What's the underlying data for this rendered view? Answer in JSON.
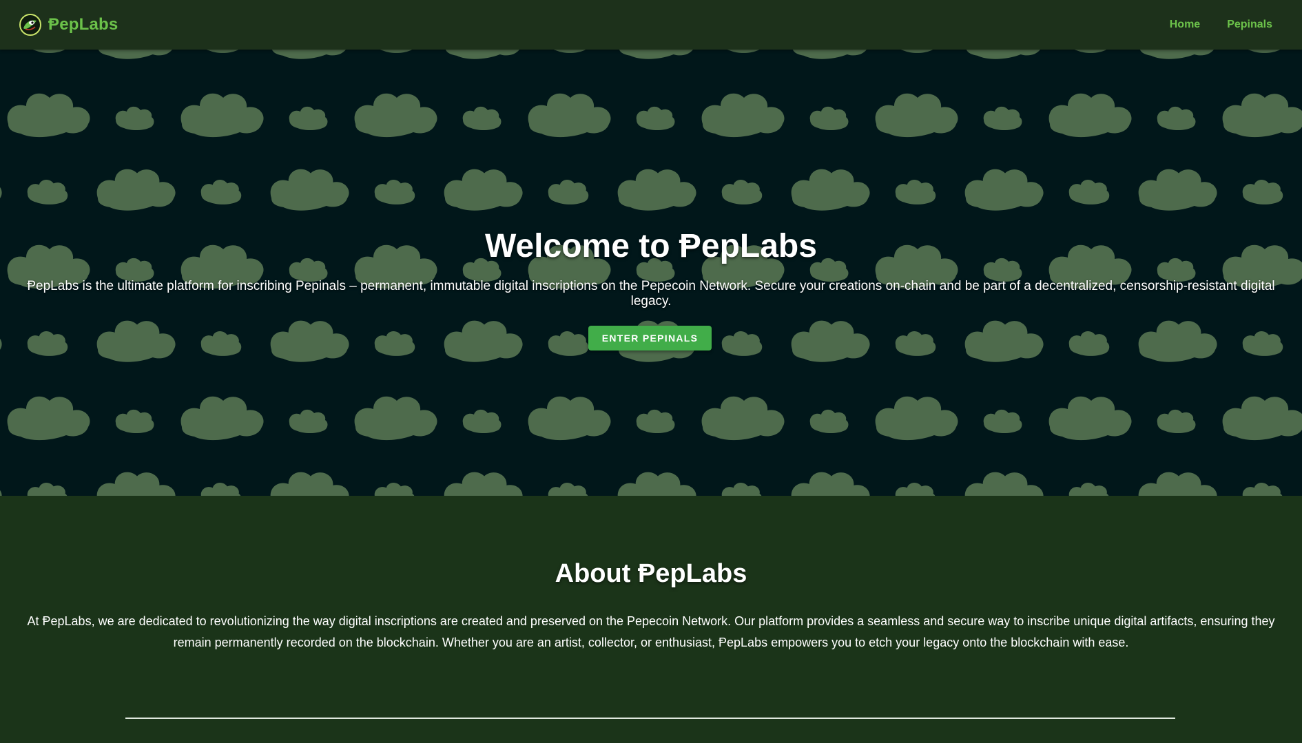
{
  "navbar": {
    "brand_name": "ⱣepLabs",
    "links": [
      {
        "label": "Home"
      },
      {
        "label": "Pepinals"
      }
    ]
  },
  "hero": {
    "title": "Welcome to ⱣepLabs",
    "description": "ⱣepLabs is the ultimate platform for inscribing Pepinals – permanent, immutable digital inscriptions on the Pepecoin Network. Secure your creations on-chain and be part of a decentralized, censorship-resistant digital legacy.",
    "cta_label": "ENTER PEPINALS"
  },
  "about": {
    "title": "About ⱣepLabs",
    "text": "At ⱣepLabs, we are dedicated to revolutionizing the way digital inscriptions are created and preserved on the Pepecoin Network. Our platform provides a seamless and secure way to inscribe unique digital artifacts, ensuring they remain permanently recorded on the blockchain. Whether you are an artist, collector, or enthusiast, ⱣepLabs empowers you to etch your legacy onto the blockchain with ease."
  },
  "colors": {
    "accent": "#6cc24a",
    "button": "#41ad49",
    "nav_background": "#1d311b",
    "hero_background": "#01171a",
    "cloud": "#4e6b4c",
    "about_background": "#1b3419"
  },
  "icons": {
    "logo": "pepe-frog-logo-icon",
    "pattern": "cloud-pattern"
  }
}
